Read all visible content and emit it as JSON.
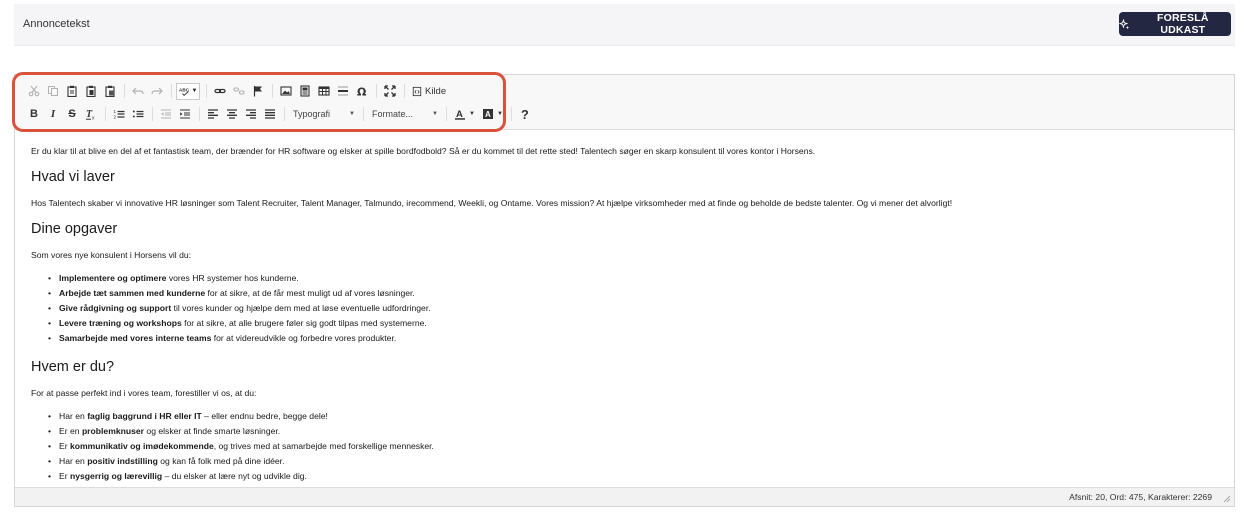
{
  "panel": {
    "title": "Annoncetekst",
    "suggest_button": "FORESLÅ UDKAST"
  },
  "toolbar": {
    "source_label": "Kilde",
    "styles_label": "Typografi",
    "format_label": "Formate...",
    "help_label": "?",
    "bold_label": "B",
    "italic_label": "I",
    "strike_label": "S"
  },
  "content": {
    "intro": "Er du klar til at blive en del af et fantastisk team, der brænder for HR software og elsker at spille bordfodbold? Så er du kommet til det rette sted! Talentech søger en skarp konsulent til vores kontor i Horsens.",
    "h1": "Hvad vi laver",
    "p1": "Hos Talentech skaber vi innovative HR løsninger som Talent Recruiter, Talent Manager, Talmundo, irecommend, Weekli, og Ontame. Vores mission? At hjælpe virksomheder med at finde og beholde de bedste talenter. Og vi mener det alvorligt!",
    "h2": "Dine opgaver",
    "p2": "Som vores nye konsulent i Horsens vil du:",
    "tasks": [
      {
        "bold": "Implementere og optimere",
        "rest": " vores HR systemer hos kunderne."
      },
      {
        "bold": "Arbejde tæt sammen med kunderne",
        "rest": " for at sikre, at de får mest muligt ud af vores løsninger."
      },
      {
        "bold": "Give rådgivning og support",
        "rest": " til vores kunder og hjælpe dem med at løse eventuelle udfordringer."
      },
      {
        "bold": "Levere træning og workshops",
        "rest": " for at sikre, at alle brugere føler sig godt tilpas med systemerne."
      },
      {
        "bold": "Samarbejde med vores interne teams",
        "rest": " for at videreudvikle og forbedre vores produkter."
      }
    ],
    "h3": "Hvem er du?",
    "p3": "For at passe perfekt ind i vores team, forestiller vi os, at du:",
    "traits": [
      {
        "pre": "Har en ",
        "bold": "faglig baggrund i HR eller IT",
        "rest": " – eller endnu bedre, begge dele!"
      },
      {
        "pre": "Er en ",
        "bold": "problemknuser",
        "rest": " og elsker at finde smarte løsninger."
      },
      {
        "pre": "Er ",
        "bold": "kommunikativ og imødekommende",
        "rest": ", og trives med at samarbejde med forskellige mennesker."
      },
      {
        "pre": "Har en ",
        "bold": "positiv indstilling",
        "rest": " og kan få folk med på dine idéer."
      },
      {
        "pre": "Er ",
        "bold": "nysgerrig og lærevillig",
        "rest": " – du elsker at lære nyt og udvikle dig."
      }
    ]
  },
  "status": {
    "text": "Afsnit: 20, Ord: 475, Karakterer: 2269"
  },
  "colors": {
    "button_bg": "#232741",
    "highlight": "#d9533b"
  }
}
